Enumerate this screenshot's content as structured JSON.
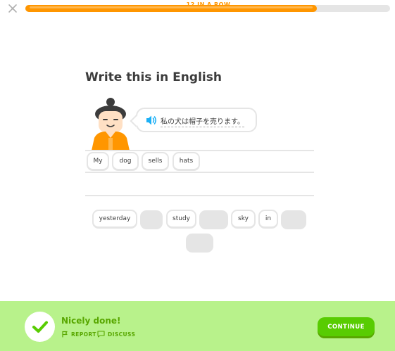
{
  "header": {
    "close_icon": "close-icon",
    "streak_text": "12 IN A ROW",
    "progress_fraction": 0.8
  },
  "exercise": {
    "title": "Write this in English",
    "speaker_icon": "speaker-icon",
    "prompt_text": "私の犬は帽子を売ります。",
    "answer_words": [
      "My",
      "dog",
      "sells",
      "hats"
    ],
    "bank_words": [
      "yesterday",
      "study",
      "sky",
      "in"
    ]
  },
  "footer": {
    "check_icon": "checkmark-icon",
    "title": "Nicely done!",
    "report_label": "REPORT",
    "discuss_label": "DISCUSS",
    "continue_label": "CONTINUE"
  },
  "colors": {
    "progress": "#ff9600",
    "success_bg": "#b8f28b",
    "success_text": "#58a700",
    "button": "#58cc02",
    "speaker": "#1cb0f6"
  }
}
